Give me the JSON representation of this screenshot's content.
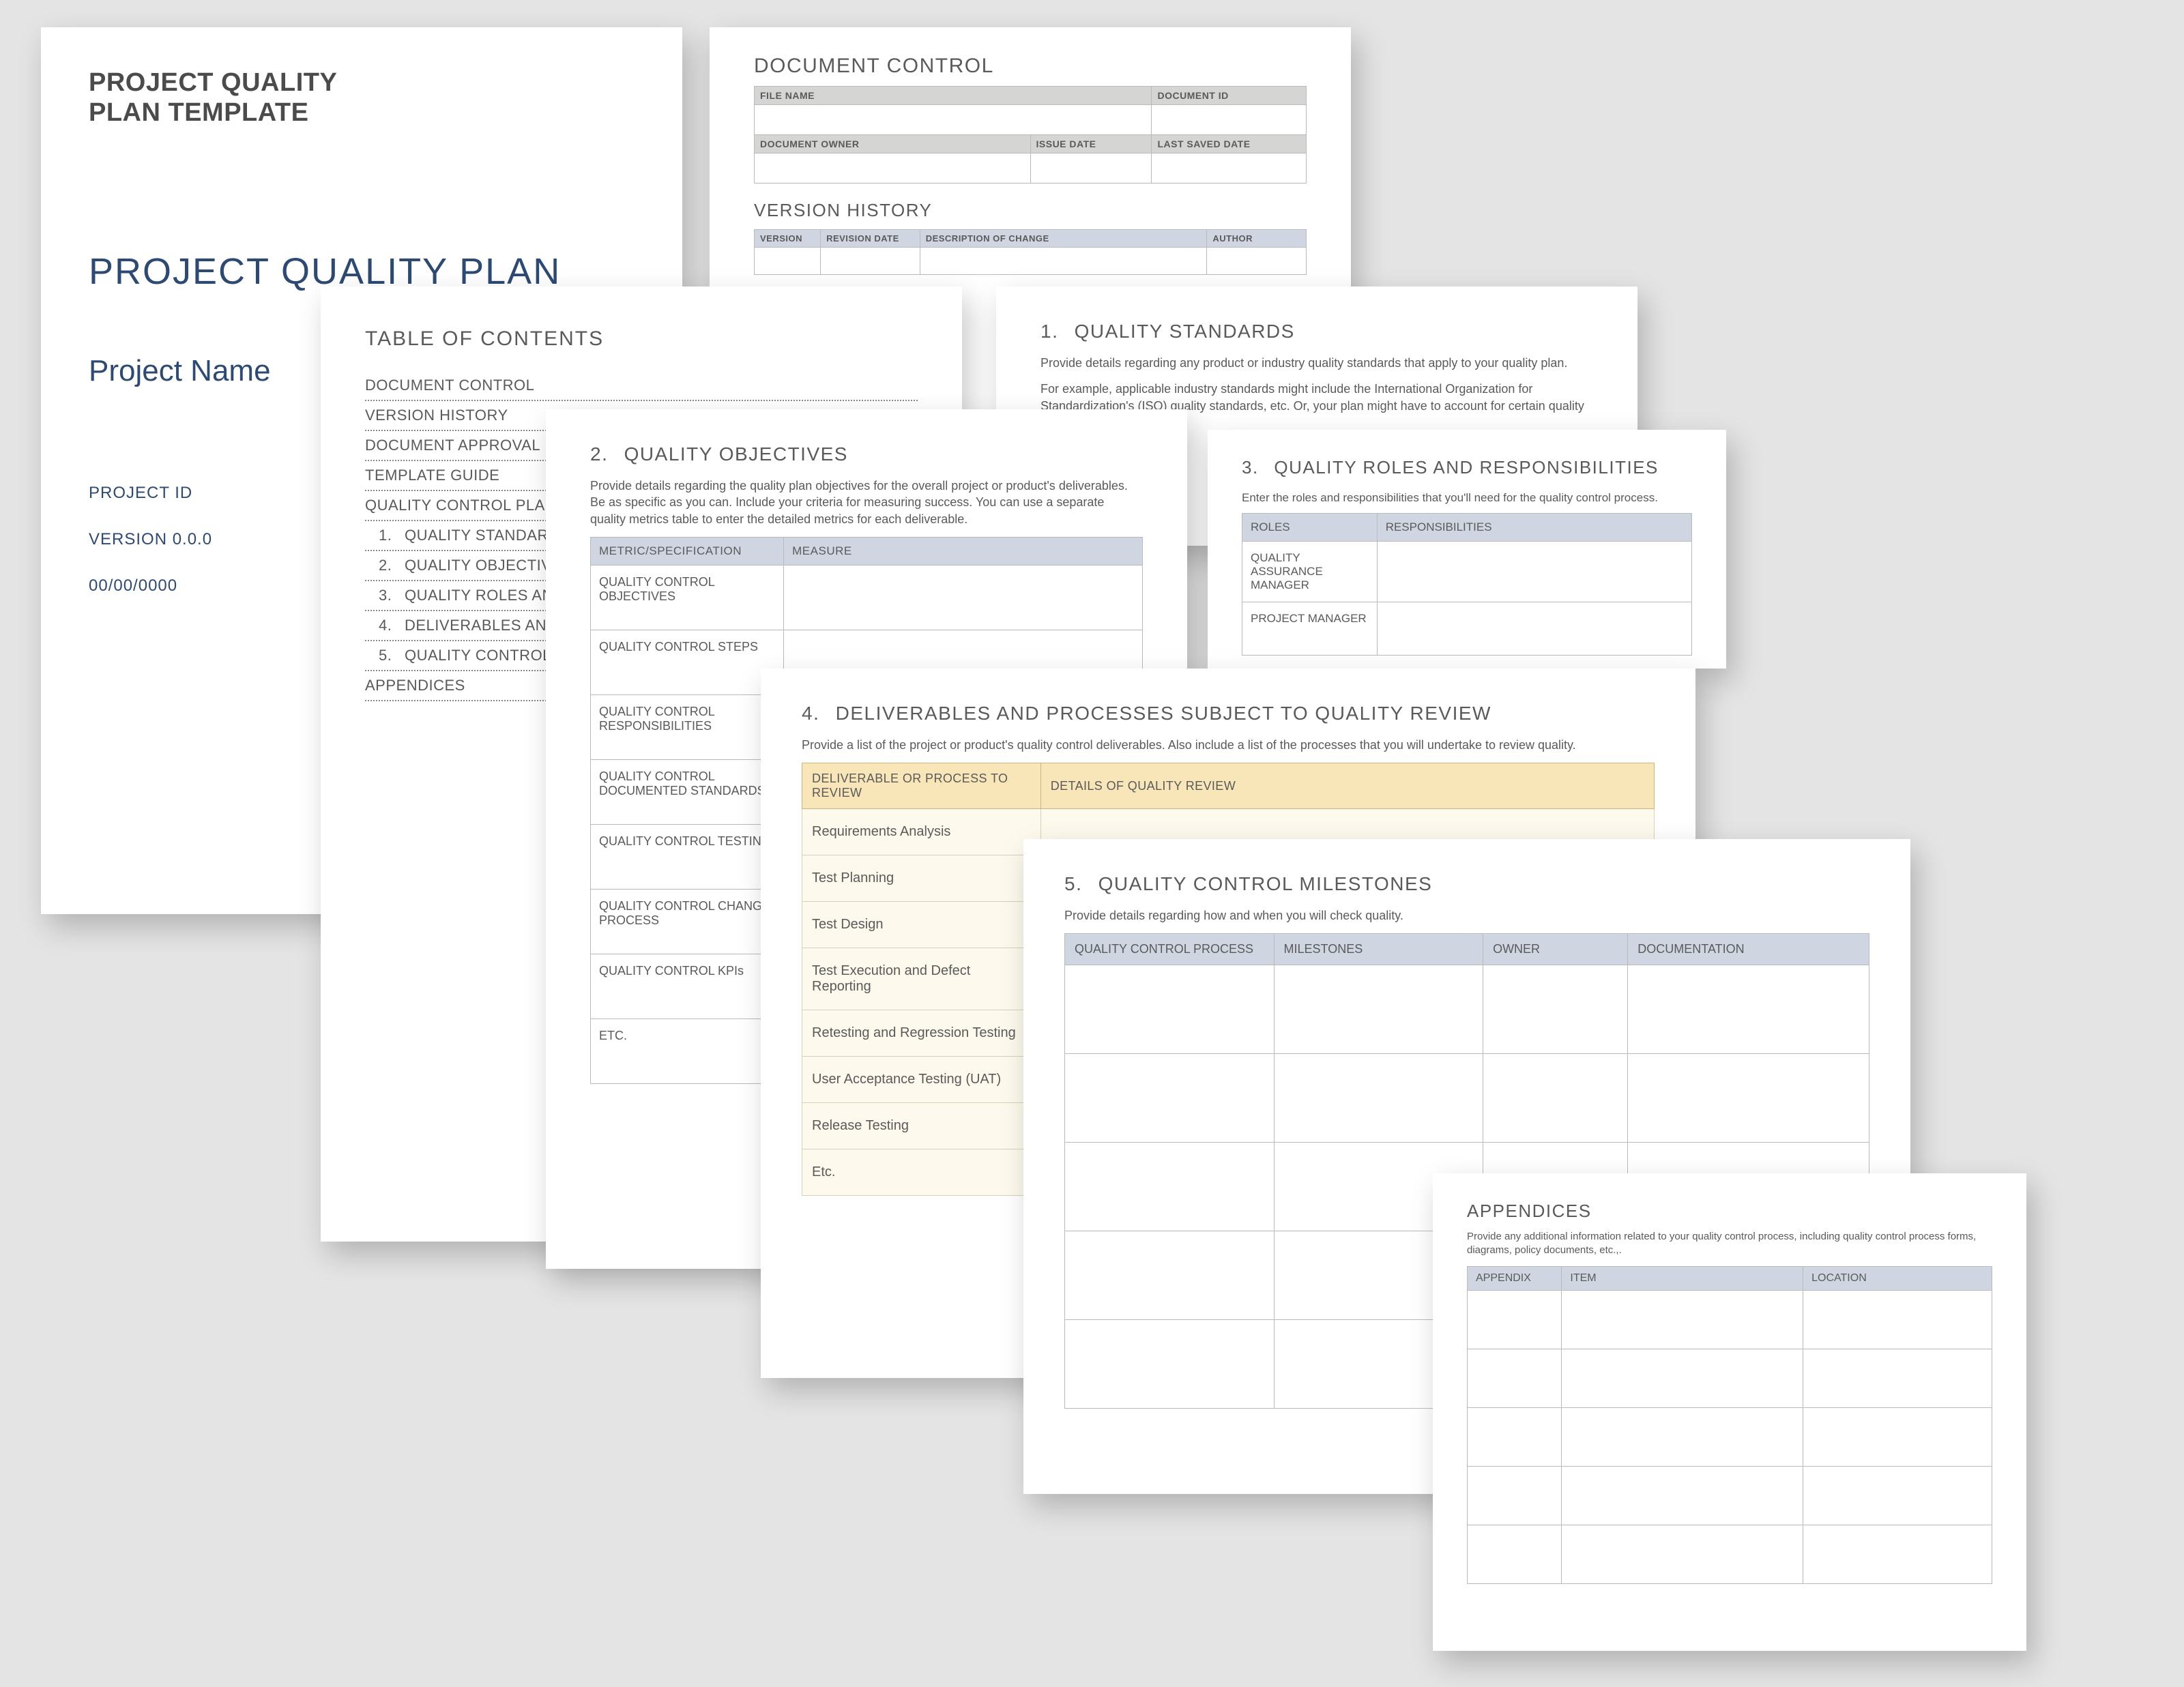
{
  "title_page": {
    "template_line1": "PROJECT QUALITY",
    "template_line2": "PLAN TEMPLATE",
    "doc_title": "PROJECT QUALITY PLAN",
    "project_name": "Project Name",
    "project_id_label": "PROJECT ID",
    "version_label": "VERSION 0.0.0",
    "date_label": "00/00/0000"
  },
  "doc_control": {
    "title": "DOCUMENT CONTROL",
    "headers1": {
      "file_name": "FILE NAME",
      "doc_id": "DOCUMENT ID"
    },
    "headers2": {
      "owner": "DOCUMENT OWNER",
      "issue": "ISSUE DATE",
      "saved": "LAST SAVED DATE"
    },
    "vh_title": "VERSION HISTORY",
    "vh_headers": {
      "version": "VERSION",
      "rev_date": "REVISION DATE",
      "desc": "DESCRIPTION OF CHANGE",
      "author": "AUTHOR"
    }
  },
  "toc": {
    "title": "TABLE OF CONTENTS",
    "items": [
      "DOCUMENT CONTROL",
      "VERSION HISTORY",
      "DOCUMENT APPROVAL",
      "TEMPLATE GUIDE",
      "QUALITY CONTROL PLAN"
    ],
    "numbered": [
      {
        "n": "1.",
        "label": "QUALITY STANDARDS"
      },
      {
        "n": "2.",
        "label": "QUALITY OBJECTIVES"
      },
      {
        "n": "3.",
        "label": "QUALITY ROLES AND"
      },
      {
        "n": "4.",
        "label": "DELIVERABLES AND"
      },
      {
        "n": "5.",
        "label": "QUALITY CONTROL"
      }
    ],
    "appendices": "APPENDICES"
  },
  "standards": {
    "title_n": "1.",
    "title": "QUALITY STANDARDS",
    "p1": "Provide details regarding any product or industry quality standards that apply to your quality plan.",
    "p2": "For example, applicable industry standards might include the International Organization for Standardization's (ISO) quality standards, etc. Or, your plan might have to account for certain quality comp"
  },
  "objectives": {
    "title_n": "2.",
    "title": "QUALITY OBJECTIVES",
    "descr": "Provide details regarding the quality plan objectives for the overall project or product's deliverables. Be as specific as you can. Include your criteria for measuring success. You can use a separate quality metrics table to enter the detailed metrics for each deliverable.",
    "head1": "METRIC/SPECIFICATION",
    "head2": "MEASURE",
    "rows": [
      "QUALITY CONTROL OBJECTIVES",
      "QUALITY CONTROL STEPS",
      "QUALITY CONTROL RESPONSIBILITIES",
      "QUALITY CONTROL DOCUMENTED STANDARDS",
      "QUALITY CONTROL TESTING",
      "QUALITY CONTROL CHANGE PROCESS",
      "QUALITY CONTROL KPIs",
      "ETC."
    ]
  },
  "roles": {
    "title_n": "3.",
    "title": "QUALITY ROLES AND RESPONSIBILITIES",
    "descr": "Enter the roles and responsibilities that you'll need for the quality control process.",
    "head1": "ROLES",
    "head2": "RESPONSIBILITIES",
    "rows": [
      "QUALITY ASSURANCE MANAGER",
      "PROJECT MANAGER"
    ]
  },
  "deliverables": {
    "title_n": "4.",
    "title": "DELIVERABLES AND PROCESSES SUBJECT TO QUALITY REVIEW",
    "descr": "Provide a list of the project or product's quality control deliverables. Also include a list of the processes that you will undertake to review quality.",
    "head1": "DELIVERABLE OR PROCESS TO REVIEW",
    "head2": "DETAILS OF QUALITY REVIEW",
    "rows": [
      "Requirements Analysis",
      "Test Planning",
      "Test Design",
      "Test Execution and Defect Reporting",
      "Retesting and Regression Testing",
      "User Acceptance Testing (UAT)",
      "Release Testing",
      "Etc."
    ]
  },
  "milestones": {
    "title_n": "5.",
    "title": "QUALITY CONTROL MILESTONES",
    "descr": "Provide details regarding how and when you will check quality.",
    "heads": [
      "QUALITY CONTROL PROCESS",
      "MILESTONES",
      "OWNER",
      "DOCUMENTATION"
    ],
    "blank_rows": 5
  },
  "appendices": {
    "title": "APPENDICES",
    "descr": "Provide any additional information related to your quality control process, including quality control process forms, diagrams, policy documents, etc.,.",
    "heads": [
      "APPENDIX",
      "ITEM",
      "LOCATION"
    ],
    "blank_rows": 5
  }
}
